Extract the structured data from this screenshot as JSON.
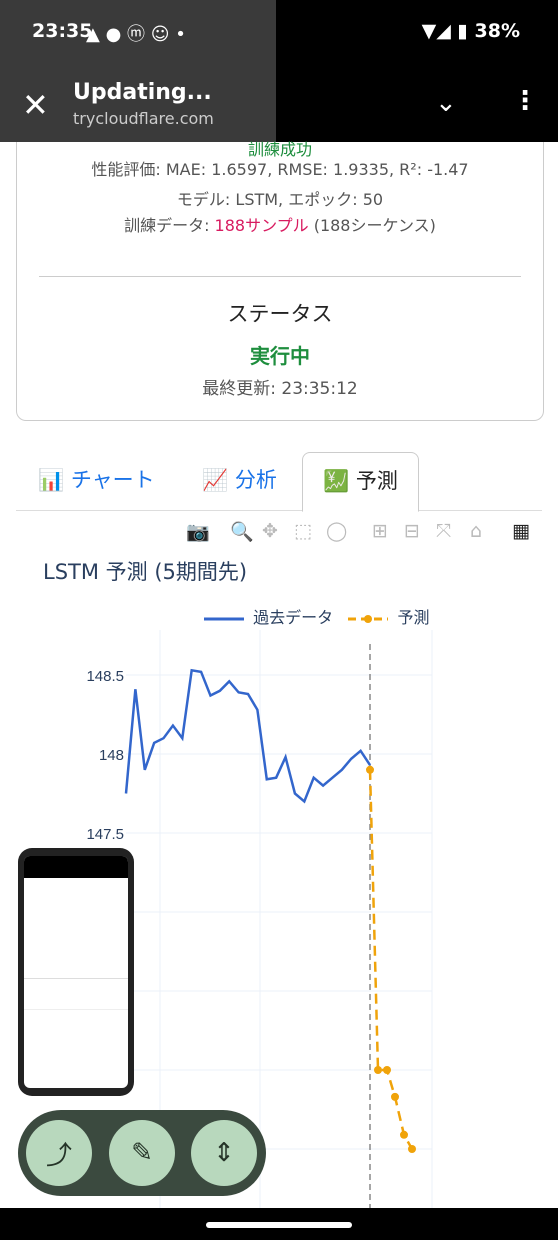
{
  "status_bar": {
    "time": "23:35",
    "battery": "38%"
  },
  "app_bar": {
    "title": "Updating...",
    "url": "trycloudflare.com"
  },
  "card": {
    "cut_text": "訓練成功",
    "metrics": "性能評価: MAE: 1.6597, RMSE: 1.9335, R²: -1.47",
    "model": "モデル: LSTM, エポック: 50",
    "train_label": "訓練データ: ",
    "train_samples": "188サンプル",
    "train_seq": " (188シーケンス)",
    "status_heading": "ステータス",
    "status_value": "実行中",
    "last_update": "最終更新: 23:35:12",
    "status_color": "#1e8e3e"
  },
  "tabs": [
    {
      "icon": "📊",
      "label": "チャート"
    },
    {
      "icon": "📈",
      "label": "分析"
    },
    {
      "icon": "💹",
      "label": "予測"
    }
  ],
  "chart_data": {
    "type": "line",
    "title": "LSTM 予測 (5期間先)",
    "legend": [
      "過去データ",
      "予測"
    ],
    "y_ticks": [
      "148.5",
      "148",
      "147.5"
    ],
    "colors": {
      "history": "#3366cc",
      "forecast": "#f0a30a"
    },
    "history": [
      147.75,
      148.41,
      147.9,
      148.07,
      148.1,
      148.18,
      148.1,
      148.53,
      148.52,
      148.37,
      148.4,
      148.46,
      148.39,
      148.38,
      148.28,
      147.84,
      147.85,
      147.98,
      147.75,
      147.7,
      147.85,
      147.8,
      147.85,
      147.9,
      147.97,
      148.02,
      147.93
    ],
    "forecast": [
      147.9,
      146.0,
      146.0,
      145.83,
      145.59,
      145.5
    ]
  }
}
